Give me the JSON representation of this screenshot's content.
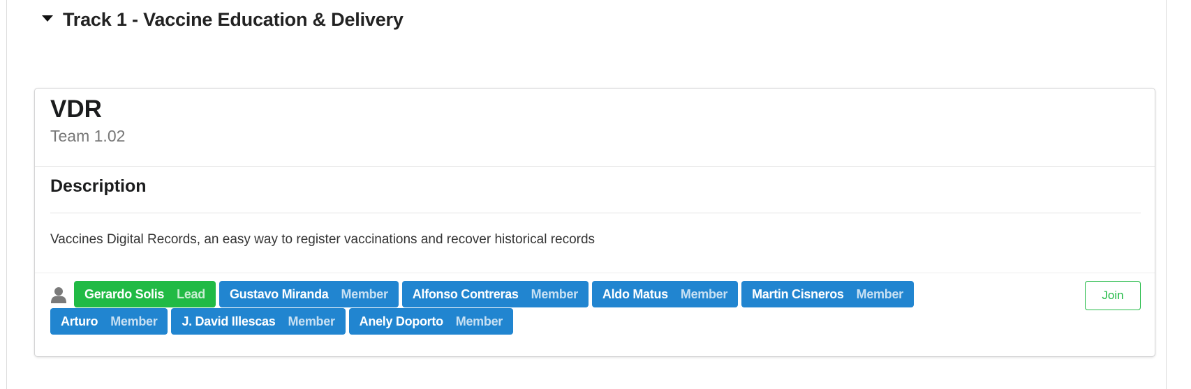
{
  "track": {
    "title": "Track 1 - Vaccine Education & Delivery"
  },
  "team": {
    "name": "VDR",
    "number": "Team 1.02",
    "description_heading": "Description",
    "description": "Vaccines Digital Records, an easy way to register vaccinations and recover historical records",
    "join_label": "Join",
    "members": [
      {
        "name": "Gerardo Solis",
        "role": "Lead",
        "color": "#21ba45"
      },
      {
        "name": "Gustavo Miranda",
        "role": "Member",
        "color": "#2185d0"
      },
      {
        "name": "Alfonso Contreras",
        "role": "Member",
        "color": "#2185d0"
      },
      {
        "name": "Aldo Matus",
        "role": "Member",
        "color": "#2185d0"
      },
      {
        "name": "Martin Cisneros",
        "role": "Member",
        "color": "#2185d0"
      },
      {
        "name": "Arturo",
        "role": "Member",
        "color": "#2185d0"
      },
      {
        "name": "J. David Illescas",
        "role": "Member",
        "color": "#2185d0"
      },
      {
        "name": "Anely Doporto",
        "role": "Member",
        "color": "#2185d0"
      }
    ]
  },
  "icons": {
    "track_toggle": "caret-down-icon",
    "members": "user-icon"
  },
  "colors": {
    "lead": "#21ba45",
    "member": "#2185d0",
    "join": "#21ba45"
  }
}
